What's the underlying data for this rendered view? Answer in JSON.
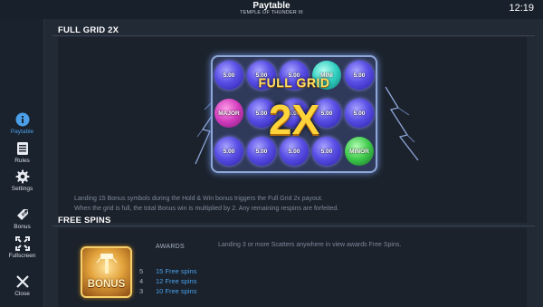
{
  "header": {
    "title": "Paytable",
    "subtitle": "TEMPLE OF THUNDER III",
    "clock": "12:19"
  },
  "sidebar": {
    "items": [
      {
        "label": "Paytable",
        "icon": "info-icon",
        "active": true
      },
      {
        "label": "Rules",
        "icon": "rules-icon",
        "active": false
      },
      {
        "label": "Settings",
        "icon": "gear-icon",
        "active": false
      },
      {
        "label": "Bonus",
        "icon": "bonus-tag-icon",
        "active": false
      },
      {
        "label": "Fullscreen",
        "icon": "fullscreen-icon",
        "active": false
      },
      {
        "label": "Close",
        "icon": "close-icon",
        "active": false
      }
    ]
  },
  "full_grid": {
    "title": "FULL GRID 2X",
    "banner": "FULL GRID",
    "multiplier": "2X",
    "grid": [
      [
        "5.00",
        "5.00",
        "5.00",
        "MINI",
        "5.00"
      ],
      [
        "MAJOR",
        "5.00",
        "5.00",
        "5.00",
        "5.00"
      ],
      [
        "5.00",
        "5.00",
        "5.00",
        "5.00",
        "MINOR"
      ]
    ],
    "description_line1": "Landing 15 Bonus symbols during the Hold & Win bonus triggers the Full Grid 2x payout.",
    "description_line2": "When the grid is full, the total Bonus win is multiplied by 2. Any remaining respins are forfeited."
  },
  "free_spins": {
    "title": "FREE SPINS",
    "bonus_symbol_label": "BONUS",
    "awards_header": "AWARDS",
    "awards": [
      {
        "count": "5",
        "value": "15 Free spins"
      },
      {
        "count": "4",
        "value": "12 Free spins"
      },
      {
        "count": "3",
        "value": "10 Free spins"
      }
    ],
    "description": "Landing 3 or more Scatters anywhere in view awards Free Spins."
  },
  "colors": {
    "accent": "#4a9fe8",
    "background": "#222a36",
    "panel": "#1b222c",
    "gold": "#ffd43a"
  }
}
